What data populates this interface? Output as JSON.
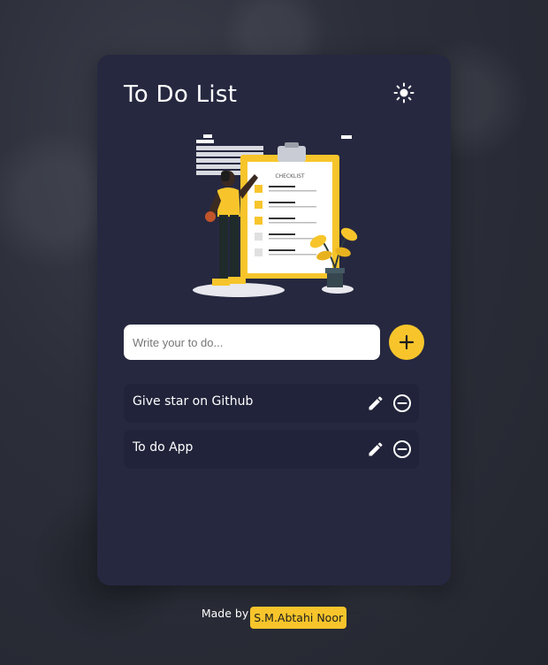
{
  "app": {
    "title": "To Do List",
    "theme_icon": "sun-icon"
  },
  "illustration": {
    "checklist_label": "CHECKLIST"
  },
  "input": {
    "placeholder": "Write your to do...",
    "value": "",
    "add_icon": "plus-icon"
  },
  "todos": [
    {
      "text": "Give star on Github",
      "edit_icon": "pencil-icon",
      "remove_icon": "minus-circle-icon"
    },
    {
      "text": "To do App",
      "edit_icon": "pencil-icon",
      "remove_icon": "minus-circle-icon"
    }
  ],
  "footer": {
    "label": "Made by",
    "author": "S.M.Abtahi Noor"
  },
  "colors": {
    "card_bg": "#262840",
    "item_bg": "#21233a",
    "accent": "#f7c52b",
    "text": "#ffffff"
  }
}
